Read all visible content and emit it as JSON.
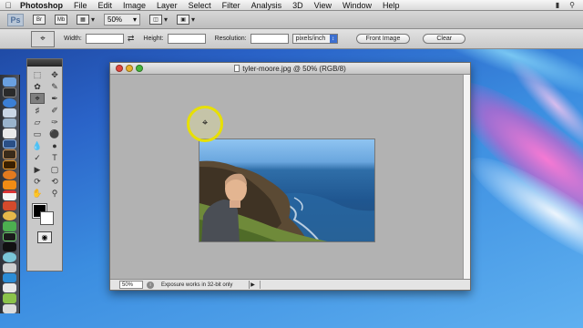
{
  "menubar": {
    "app_name": "Photoshop",
    "items": [
      "File",
      "Edit",
      "Image",
      "Layer",
      "Select",
      "Filter",
      "Analysis",
      "3D",
      "View",
      "Window",
      "Help"
    ]
  },
  "appbar": {
    "logo": "Ps",
    "bridge_label": "Br",
    "minibridge_label": "Mb",
    "zoom": "50%"
  },
  "options": {
    "width_label": "Width:",
    "width_value": "",
    "height_label": "Height:",
    "height_value": "",
    "resolution_label": "Resolution:",
    "resolution_value": "",
    "units": "pixels/inch",
    "front_image_label": "Front Image",
    "clear_label": "Clear"
  },
  "document": {
    "title": "tyler-moore.jpg @ 50% (RGB/8)",
    "zoom_field": "50%",
    "status_text": "Exposure works in 32-bit only"
  },
  "colors": {
    "foreground": "#000000",
    "background": "#ffffff",
    "cursor_highlight": "#e8e000"
  },
  "icons": {
    "apple": "apple-icon",
    "crop_tool": "crop-icon",
    "cursor": "crop-cursor-icon"
  }
}
